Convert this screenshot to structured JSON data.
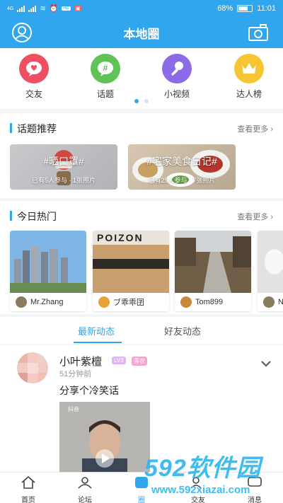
{
  "status": {
    "carrier": "4G",
    "signal_badge": "HD",
    "battery": "68%",
    "time": "11:01"
  },
  "header": {
    "title": "本地圈"
  },
  "categories": [
    {
      "label": "交友",
      "icon": "heart-chat-icon",
      "color": "#ee4f62"
    },
    {
      "label": "话题",
      "icon": "hashtag-icon",
      "color": "#5fc356"
    },
    {
      "label": "小视频",
      "icon": "microphone-icon",
      "color": "#8d6be8"
    },
    {
      "label": "达人榜",
      "icon": "crown-icon",
      "color": "#f6c534"
    }
  ],
  "topics": {
    "title": "话题推荐",
    "more": "查看更多",
    "items": [
      {
        "name": "#晒口罩#",
        "sub": "已有5人参与 · 1张照片"
      },
      {
        "name": "#宅家美食日记#",
        "sub": "已有25人参与 · 7张照片"
      }
    ]
  },
  "hot": {
    "title": "今日热门",
    "more": "查看更多",
    "items": [
      {
        "user": "Mr.Zhang"
      },
      {
        "user": "ブ乖乖囝",
        "img_text": "POIZON"
      },
      {
        "user": "Tom899"
      },
      {
        "user": "N"
      }
    ]
  },
  "tabs": {
    "latest": "最新动态",
    "friends": "好友动态"
  },
  "post": {
    "name": "小叶紫檀",
    "level": "LV3",
    "tag": "青农",
    "time": "51分钟前",
    "content": "分享个冷笑话",
    "video_brand": "抖音"
  },
  "bottom_nav": [
    {
      "label": "首页",
      "icon": "home-icon"
    },
    {
      "label": "论坛",
      "icon": "forum-icon"
    },
    {
      "label": "圈",
      "icon": "circle-icon"
    },
    {
      "label": "交友",
      "icon": "friends-icon"
    },
    {
      "label": "消息",
      "icon": "message-icon"
    }
  ],
  "watermark": {
    "logo": "592软件园",
    "url": "www.592xiazai.com"
  }
}
